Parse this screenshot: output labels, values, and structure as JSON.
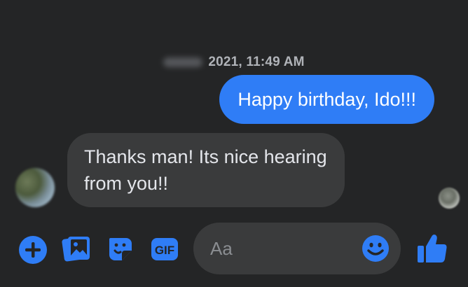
{
  "timestamp": {
    "date_redacted": "",
    "text": "2021, 11:49 AM"
  },
  "messages": [
    {
      "direction": "outgoing",
      "text": "Happy birthday, Ido!!!"
    },
    {
      "direction": "incoming",
      "text": "Thanks man! Its nice hearing from you!!"
    }
  ],
  "composer": {
    "placeholder": "Aa",
    "value": "",
    "icons": [
      "plus-icon",
      "photo-icon",
      "sticker-icon",
      "gif-icon",
      "emoji-icon",
      "like-icon"
    ],
    "gif_label": "GIF"
  },
  "colors": {
    "background": "#242526",
    "accent": "#2f7df6",
    "incoming_bubble": "#3a3b3c",
    "timestamp_text": "#b0b3b8"
  }
}
